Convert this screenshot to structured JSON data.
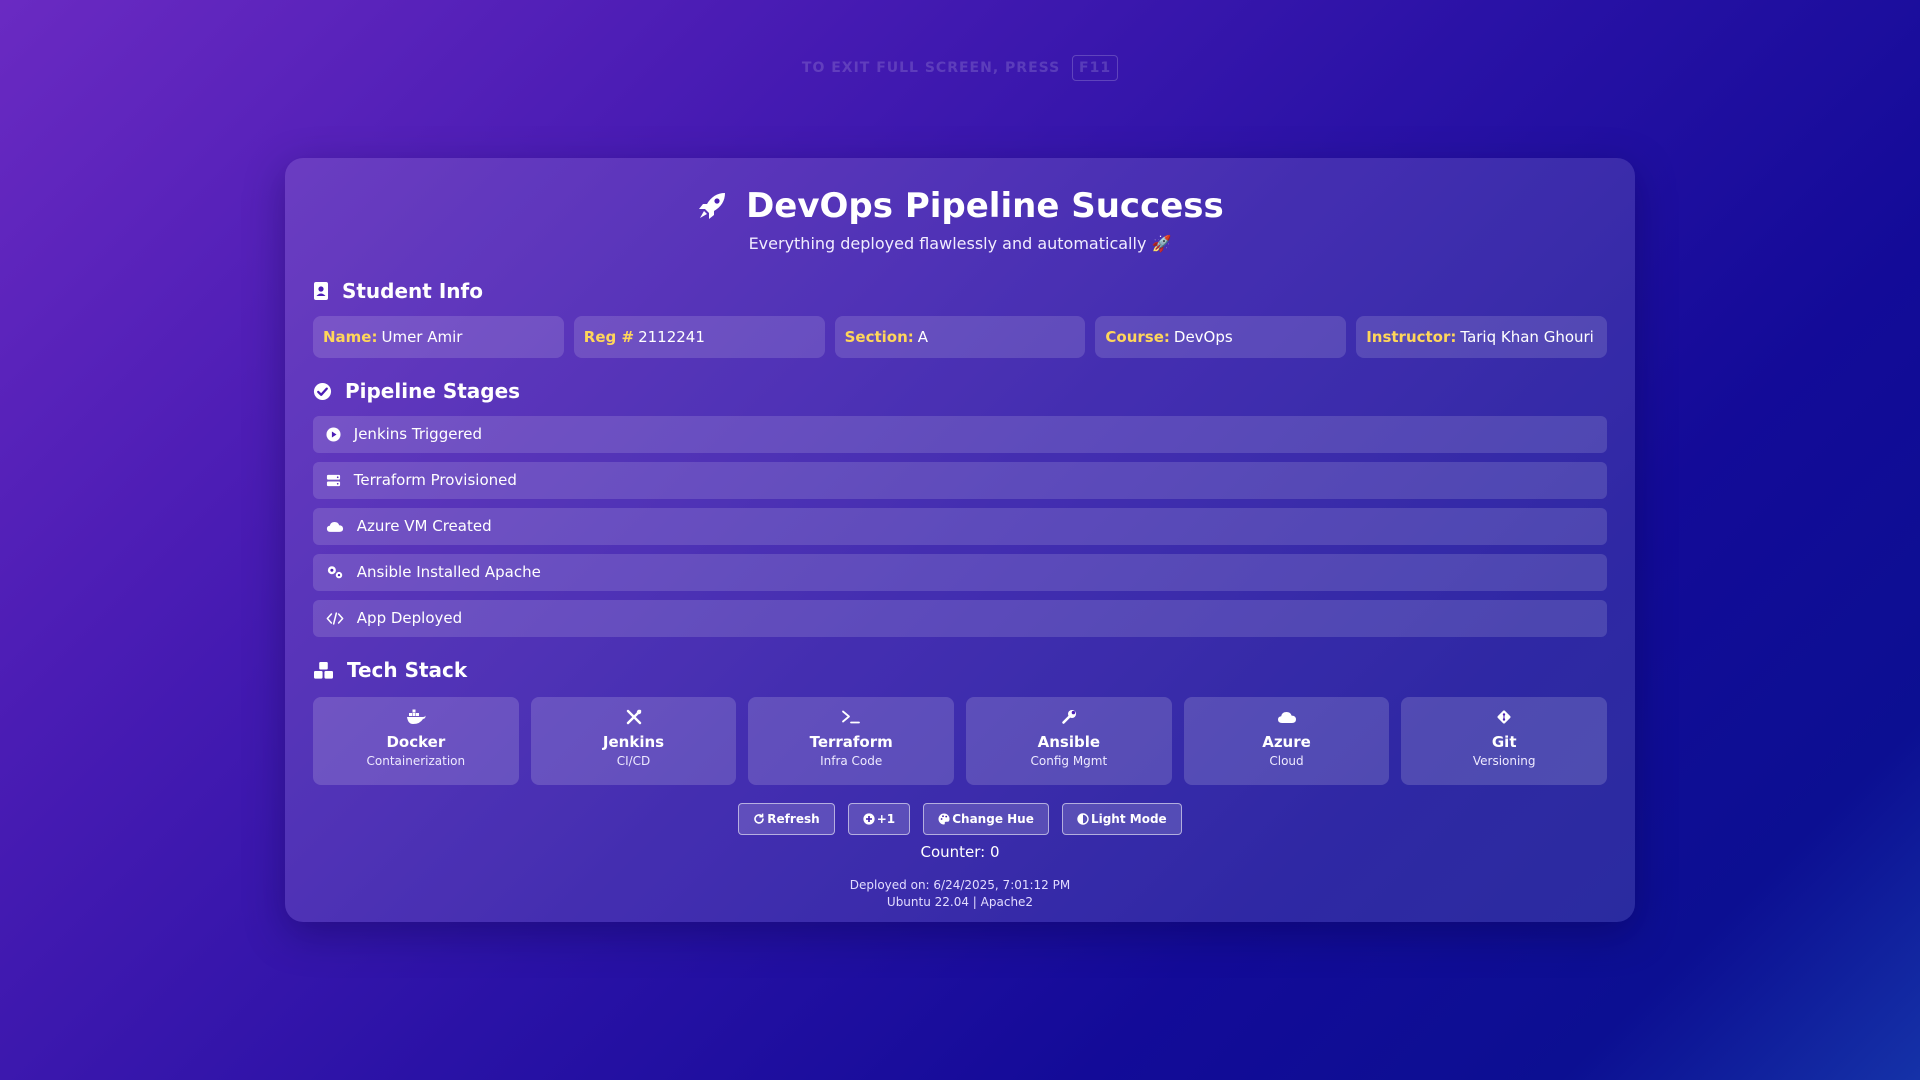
{
  "fullscreen_hint": {
    "text": "TO EXIT FULL SCREEN, PRESS",
    "key": "F11"
  },
  "header": {
    "title": "DevOps Pipeline Success",
    "subtitle": "Everything deployed flawlessly and automatically 🚀",
    "icon": "rocket-icon"
  },
  "student_info": {
    "heading": "Student Info",
    "icon": "id-badge-icon",
    "fields": [
      {
        "key": "Name:",
        "value": "Umer Amir"
      },
      {
        "key": "Reg #",
        "value": "2112241"
      },
      {
        "key": "Section:",
        "value": "A"
      },
      {
        "key": "Course:",
        "value": "DevOps"
      },
      {
        "key": "Instructor:",
        "value": "Tariq Khan Ghouri"
      }
    ]
  },
  "pipeline": {
    "heading": "Pipeline Stages",
    "icon": "check-circle-icon",
    "stages": [
      {
        "label": "Jenkins Triggered",
        "icon": "play-circle-icon"
      },
      {
        "label": "Terraform Provisioned",
        "icon": "server-icon"
      },
      {
        "label": "Azure VM Created",
        "icon": "cloud-icon"
      },
      {
        "label": "Ansible Installed Apache",
        "icon": "gears-icon"
      },
      {
        "label": "App Deployed",
        "icon": "code-icon"
      }
    ]
  },
  "tech_stack": {
    "heading": "Tech Stack",
    "icon": "cubes-icon",
    "items": [
      {
        "name": "Docker",
        "desc": "Containerization",
        "icon": "docker-icon"
      },
      {
        "name": "Jenkins",
        "desc": "CI/CD",
        "icon": "tools-icon"
      },
      {
        "name": "Terraform",
        "desc": "Infra Code",
        "icon": "terminal-icon"
      },
      {
        "name": "Ansible",
        "desc": "Config Mgmt",
        "icon": "wrench-icon"
      },
      {
        "name": "Azure",
        "desc": "Cloud",
        "icon": "cloud-icon"
      },
      {
        "name": "Git",
        "desc": "Versioning",
        "icon": "git-icon"
      }
    ]
  },
  "buttons": {
    "refresh": "Refresh",
    "plus_one": "+1",
    "change_hue": "Change Hue",
    "light_mode": "Light Mode"
  },
  "counter": {
    "text": "Counter: 0"
  },
  "footer": {
    "deployed": "Deployed on: 6/24/2025, 7:01:12 PM",
    "env": "Ubuntu 22.04 | Apache2"
  },
  "colors": {
    "label_accent": "#ffd65a",
    "background_start": "#6a2ac2",
    "background_end": "#0c0f92"
  }
}
